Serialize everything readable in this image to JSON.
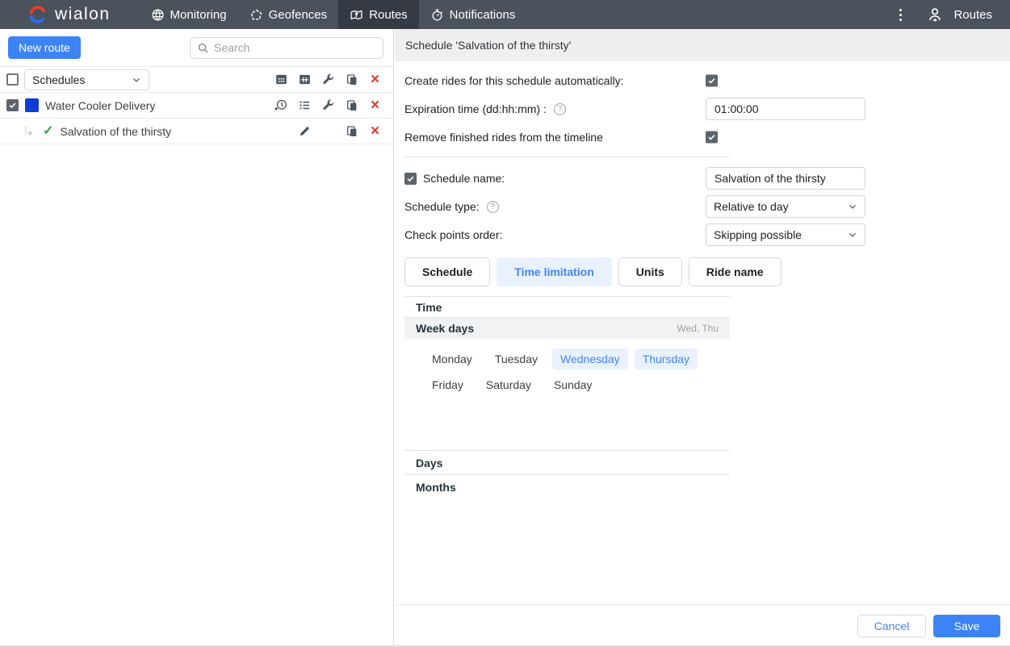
{
  "nav": {
    "brand": "wialon",
    "items": [
      {
        "label": "Monitoring",
        "icon": "globe-icon",
        "active": false
      },
      {
        "label": "Geofences",
        "icon": "geofence-polygon-icon",
        "active": false
      },
      {
        "label": "Routes",
        "icon": "route-map-icon",
        "active": true
      },
      {
        "label": "Notifications",
        "icon": "stopwatch-icon",
        "active": false
      }
    ],
    "user_menu_label": "Routes"
  },
  "sidebar": {
    "new_route_label": "New route",
    "search_placeholder": "Search",
    "group_selector_value": "Schedules",
    "header_toolbar_icons": [
      "interval-grid-icon",
      "interval-table-icon",
      "wrench-icon",
      "copy-icon",
      "delete-icon"
    ],
    "rows": [
      {
        "name": "Water Cooler Delivery",
        "checked": true,
        "color_swatch": "#0e3cd8",
        "icons": [
          "history-add-icon",
          "list-icon",
          "wrench-icon",
          "copy-icon",
          "delete-icon"
        ]
      },
      {
        "name": "Salvation of the thirsty",
        "child": true,
        "status": "active-check",
        "icons": [
          "edit-pencil-icon",
          "copy-icon",
          "delete-icon"
        ]
      }
    ]
  },
  "panel": {
    "title": "Schedule 'Salvation of the thirsty'",
    "fields": {
      "auto_create_label": "Create rides for this schedule automatically:",
      "auto_create_checked": true,
      "expiration_label": "Expiration time (dd:hh:mm)  :",
      "expiration_value": "01:00:00",
      "remove_finished_label": "Remove finished rides from the timeline",
      "remove_finished_checked": true,
      "schedule_name_label": "Schedule name:",
      "schedule_name_checked": true,
      "schedule_name_value": "Salvation of the thirsty",
      "schedule_type_label": "Schedule type:",
      "schedule_type_value": "Relative to day",
      "checkpoints_label": "Check points order:",
      "checkpoints_value": "Skipping possible"
    },
    "tabs": [
      {
        "label": "Schedule",
        "active": false
      },
      {
        "label": "Time limitation",
        "active": true
      },
      {
        "label": "Units",
        "active": false
      },
      {
        "label": "Ride name",
        "active": false
      }
    ],
    "sections": {
      "time_label": "Time",
      "week_days_label": "Week days",
      "week_days_value": "Wed, Thu",
      "days_label": "Days",
      "months_label": "Months"
    },
    "week_days": [
      {
        "label": "Monday",
        "selected": false
      },
      {
        "label": "Tuesday",
        "selected": false
      },
      {
        "label": "Wednesday",
        "selected": true
      },
      {
        "label": "Thursday",
        "selected": true
      },
      {
        "label": "Friday",
        "selected": false
      },
      {
        "label": "Saturday",
        "selected": false
      },
      {
        "label": "Sunday",
        "selected": false
      }
    ],
    "footer": {
      "cancel_label": "Cancel",
      "save_label": "Save"
    }
  },
  "colors": {
    "topbar_bg": "#4a525b",
    "topbar_active_tab_bg": "#343b44",
    "accent_blue": "#3c83f6",
    "link_blue": "#4285f4",
    "selected_chip_bg": "#e9f1fe",
    "checkbox_checked": "#5c646c",
    "delete_red": "#e23b31",
    "success_green": "#27a445",
    "route_swatch_blue": "#0e3cd8",
    "panel_header_bg": "#efefef"
  }
}
